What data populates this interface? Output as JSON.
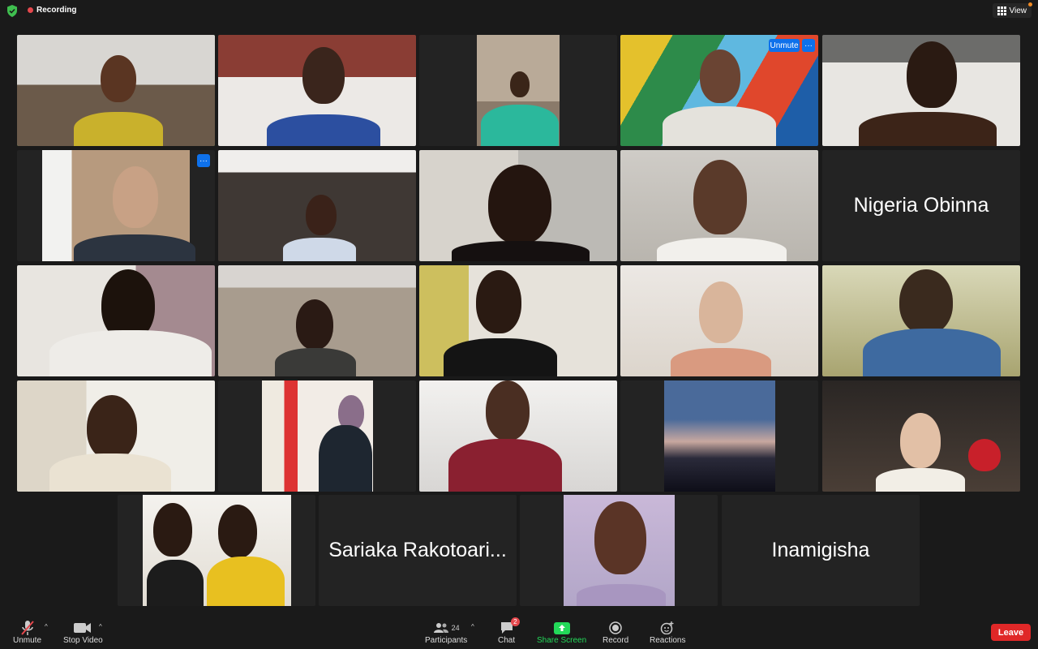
{
  "meeting": {
    "recording_label": "Recording",
    "view_label": "View"
  },
  "tiles": {
    "obinna_name": "Nigeria Obinna",
    "sariaka_name": "Sariaka Rakotoari...",
    "inamigisha_name": "Inamigisha",
    "unmute_label": "Unmute",
    "more_label": "···"
  },
  "toolbar": {
    "unmute_label": "Unmute",
    "stop_video_label": "Stop Video",
    "participants_label": "Participants",
    "participants_count": "24",
    "chat_label": "Chat",
    "chat_badge": "2",
    "share_label": "Share Screen",
    "record_label": "Record",
    "reactions_label": "Reactions",
    "leave_label": "Leave"
  },
  "colors": {
    "active_speaker": "#3fbf4f",
    "share_green": "#23d959",
    "leave_red": "#e02828",
    "accent_blue": "#0e71eb"
  }
}
